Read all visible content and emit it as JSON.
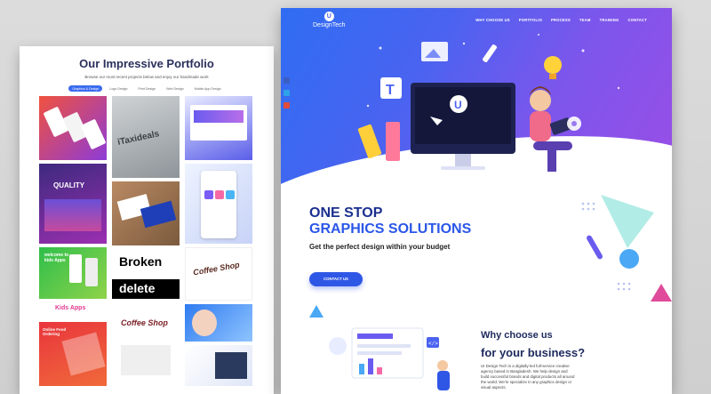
{
  "portfolio": {
    "title": "Our Impressive Portfolio",
    "subtitle": "Browse our most recent projects below and enjoy our handmade work",
    "filters": [
      "Graphics & Design",
      "Logo Design",
      "Print Design",
      "Web Design",
      "Mobile App Design"
    ],
    "tiles": {
      "itaxi": "iTaxideals",
      "broken": "Broken",
      "delete": "delete",
      "coffee": "Coffee Shop",
      "quality": "QUALITY",
      "kids": "welcome to kids Apps",
      "kidsapps": "Kids Apps",
      "coffee2": "Coffee Shop",
      "food": "Online Food Ordering"
    }
  },
  "landing": {
    "logo_mark": "U",
    "brand": "DesignTech",
    "nav": [
      "WHY CHOOSE US",
      "PORTFOLIO",
      "PROCESS",
      "TEAM",
      "TRAINING",
      "CONTACT"
    ],
    "headline_line1": "ONE STOP",
    "headline_line2": "GRAPHICS SOLUTIONS",
    "tagline": "Get the perfect design within your budget",
    "cta": "CONTACT US",
    "why_title_1": "Why choose us",
    "why_title_2": "for your business?",
    "why_body": "UI Design Tech is a digitally-led full-service creative agency based in Bangladesh. We help design and build successful brands and digital products all around the world. We're specialize in any graphics design or visual aspects."
  },
  "colors": {
    "brand_blue": "#2f57e6",
    "hero_start": "#2f6df3",
    "hero_end": "#9a4ee6",
    "heading_dark": "#1b2f8f",
    "heading_blue": "#2b57e8"
  }
}
